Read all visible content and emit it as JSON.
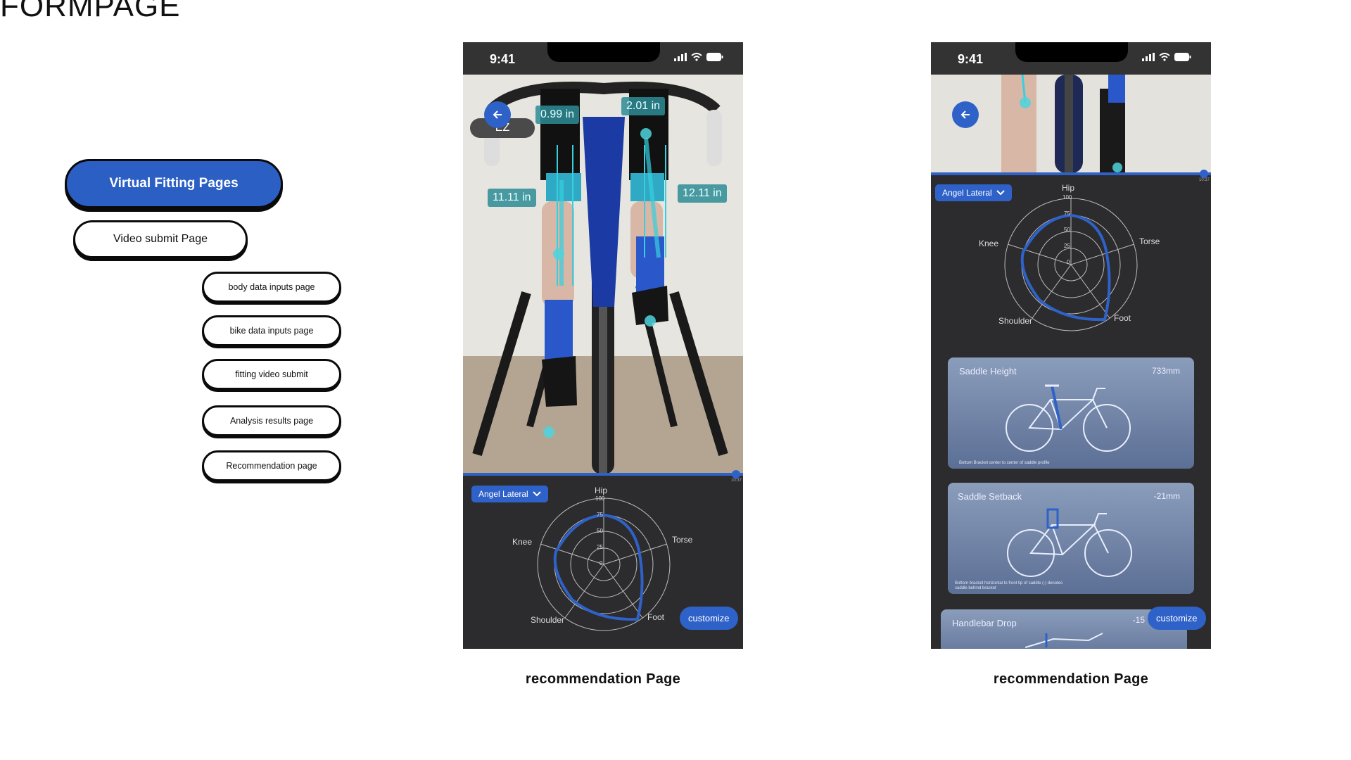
{
  "page": {
    "title": "FORMPAGE"
  },
  "flow": {
    "primary": "Virtual Fitting Pages",
    "secondary": "Video submit Page",
    "items": [
      "body data inputs page",
      "bike data inputs page",
      "fitting video submit",
      "Analysis results page",
      "Recommendation  page"
    ]
  },
  "screens": [
    {
      "time": "9:41",
      "ez_label": "EZ",
      "measurements": [
        "0.99 in",
        "2.01 in",
        "11.11 in",
        "12.11 in"
      ],
      "video_time": "10:37",
      "dropdown": "Angel Lateral",
      "radar": {
        "axes": [
          "Hip",
          "Torse",
          "Foot",
          "Shoulder",
          "Knee"
        ],
        "ticks": [
          "100",
          "75",
          "50",
          "25",
          "0"
        ]
      },
      "customize": "customize",
      "caption": "recommendation  Page"
    },
    {
      "time": "9:41",
      "video_time": "10:37",
      "dropdown": "Angel Lateral",
      "radar": {
        "axes": [
          "Hip",
          "Torse",
          "Foot",
          "Shoulder",
          "Knee"
        ],
        "ticks": [
          "100",
          "75",
          "50",
          "25",
          "0"
        ]
      },
      "cards": [
        {
          "title": "Saddle Height",
          "value": "733mm",
          "note": "Bottom Bracket center to center of saddle profile"
        },
        {
          "title": "Saddle Setback",
          "value": "-21mm",
          "note": "Bottom bracket horizontal to front tip of saddle (-) denotes saddle behind bracket"
        },
        {
          "title": "Handlebar Drop",
          "value": "-15",
          "note": ""
        }
      ],
      "customize": "customize",
      "caption": "recommendation  Page"
    }
  ],
  "colors": {
    "accent": "#2f62c9",
    "primary_pill": "#2b5fc4",
    "phone_bg": "#2c2c2e"
  },
  "icons": [
    "back-arrow-icon",
    "chevron-down-icon",
    "signal-icon",
    "wifi-icon",
    "battery-icon"
  ]
}
